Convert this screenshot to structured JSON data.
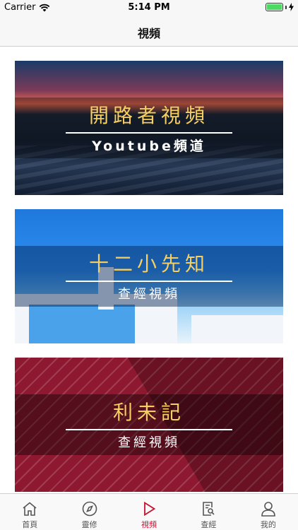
{
  "status_bar": {
    "carrier": "Carrier",
    "time": "5:14 PM"
  },
  "nav": {
    "title": "視頻"
  },
  "banners": [
    {
      "title": "開路者視頻",
      "subtitle": "Youtube頻道"
    },
    {
      "title": "十二小先知",
      "subtitle": "查經視頻"
    },
    {
      "title": "利未記",
      "subtitle": "查經視頻"
    }
  ],
  "tabs": [
    {
      "label": "首頁",
      "icon": "home-icon"
    },
    {
      "label": "靈修",
      "icon": "compass-icon"
    },
    {
      "label": "視頻",
      "icon": "play-icon",
      "active": true
    },
    {
      "label": "查經",
      "icon": "document-search-icon"
    },
    {
      "label": "我的",
      "icon": "user-icon"
    }
  ],
  "colors": {
    "accent": "#c8102e",
    "banner_title": "#f6cf63"
  }
}
